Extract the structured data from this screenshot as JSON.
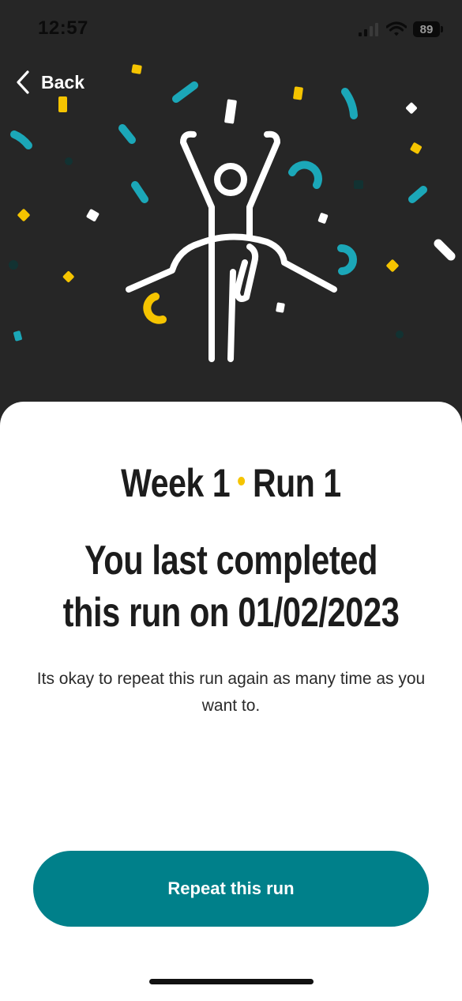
{
  "status_bar": {
    "time": "12:57",
    "battery": "89"
  },
  "nav": {
    "back_label": "Back"
  },
  "card": {
    "week_label": "Week 1",
    "run_label": "Run 1",
    "title": "You last completed this run on 01/02/2023",
    "body": "Its okay to repeat this run again as many time as you want to.",
    "button_label": "Repeat this run"
  },
  "icons": {
    "back": "chevron-left-icon",
    "signal": "cellular-signal-icon",
    "wifi": "wifi-icon",
    "battery": "battery-icon",
    "hero": "runner-finish-line-illustration",
    "confetti": "confetti-decoration"
  },
  "colors": {
    "header_background": "#262626",
    "card_background": "#ffffff",
    "primary": "#00808a",
    "accent_yellow": "#f5c400",
    "accent_teal": "#1ba7b8",
    "text_dark": "#1c1c1c"
  }
}
